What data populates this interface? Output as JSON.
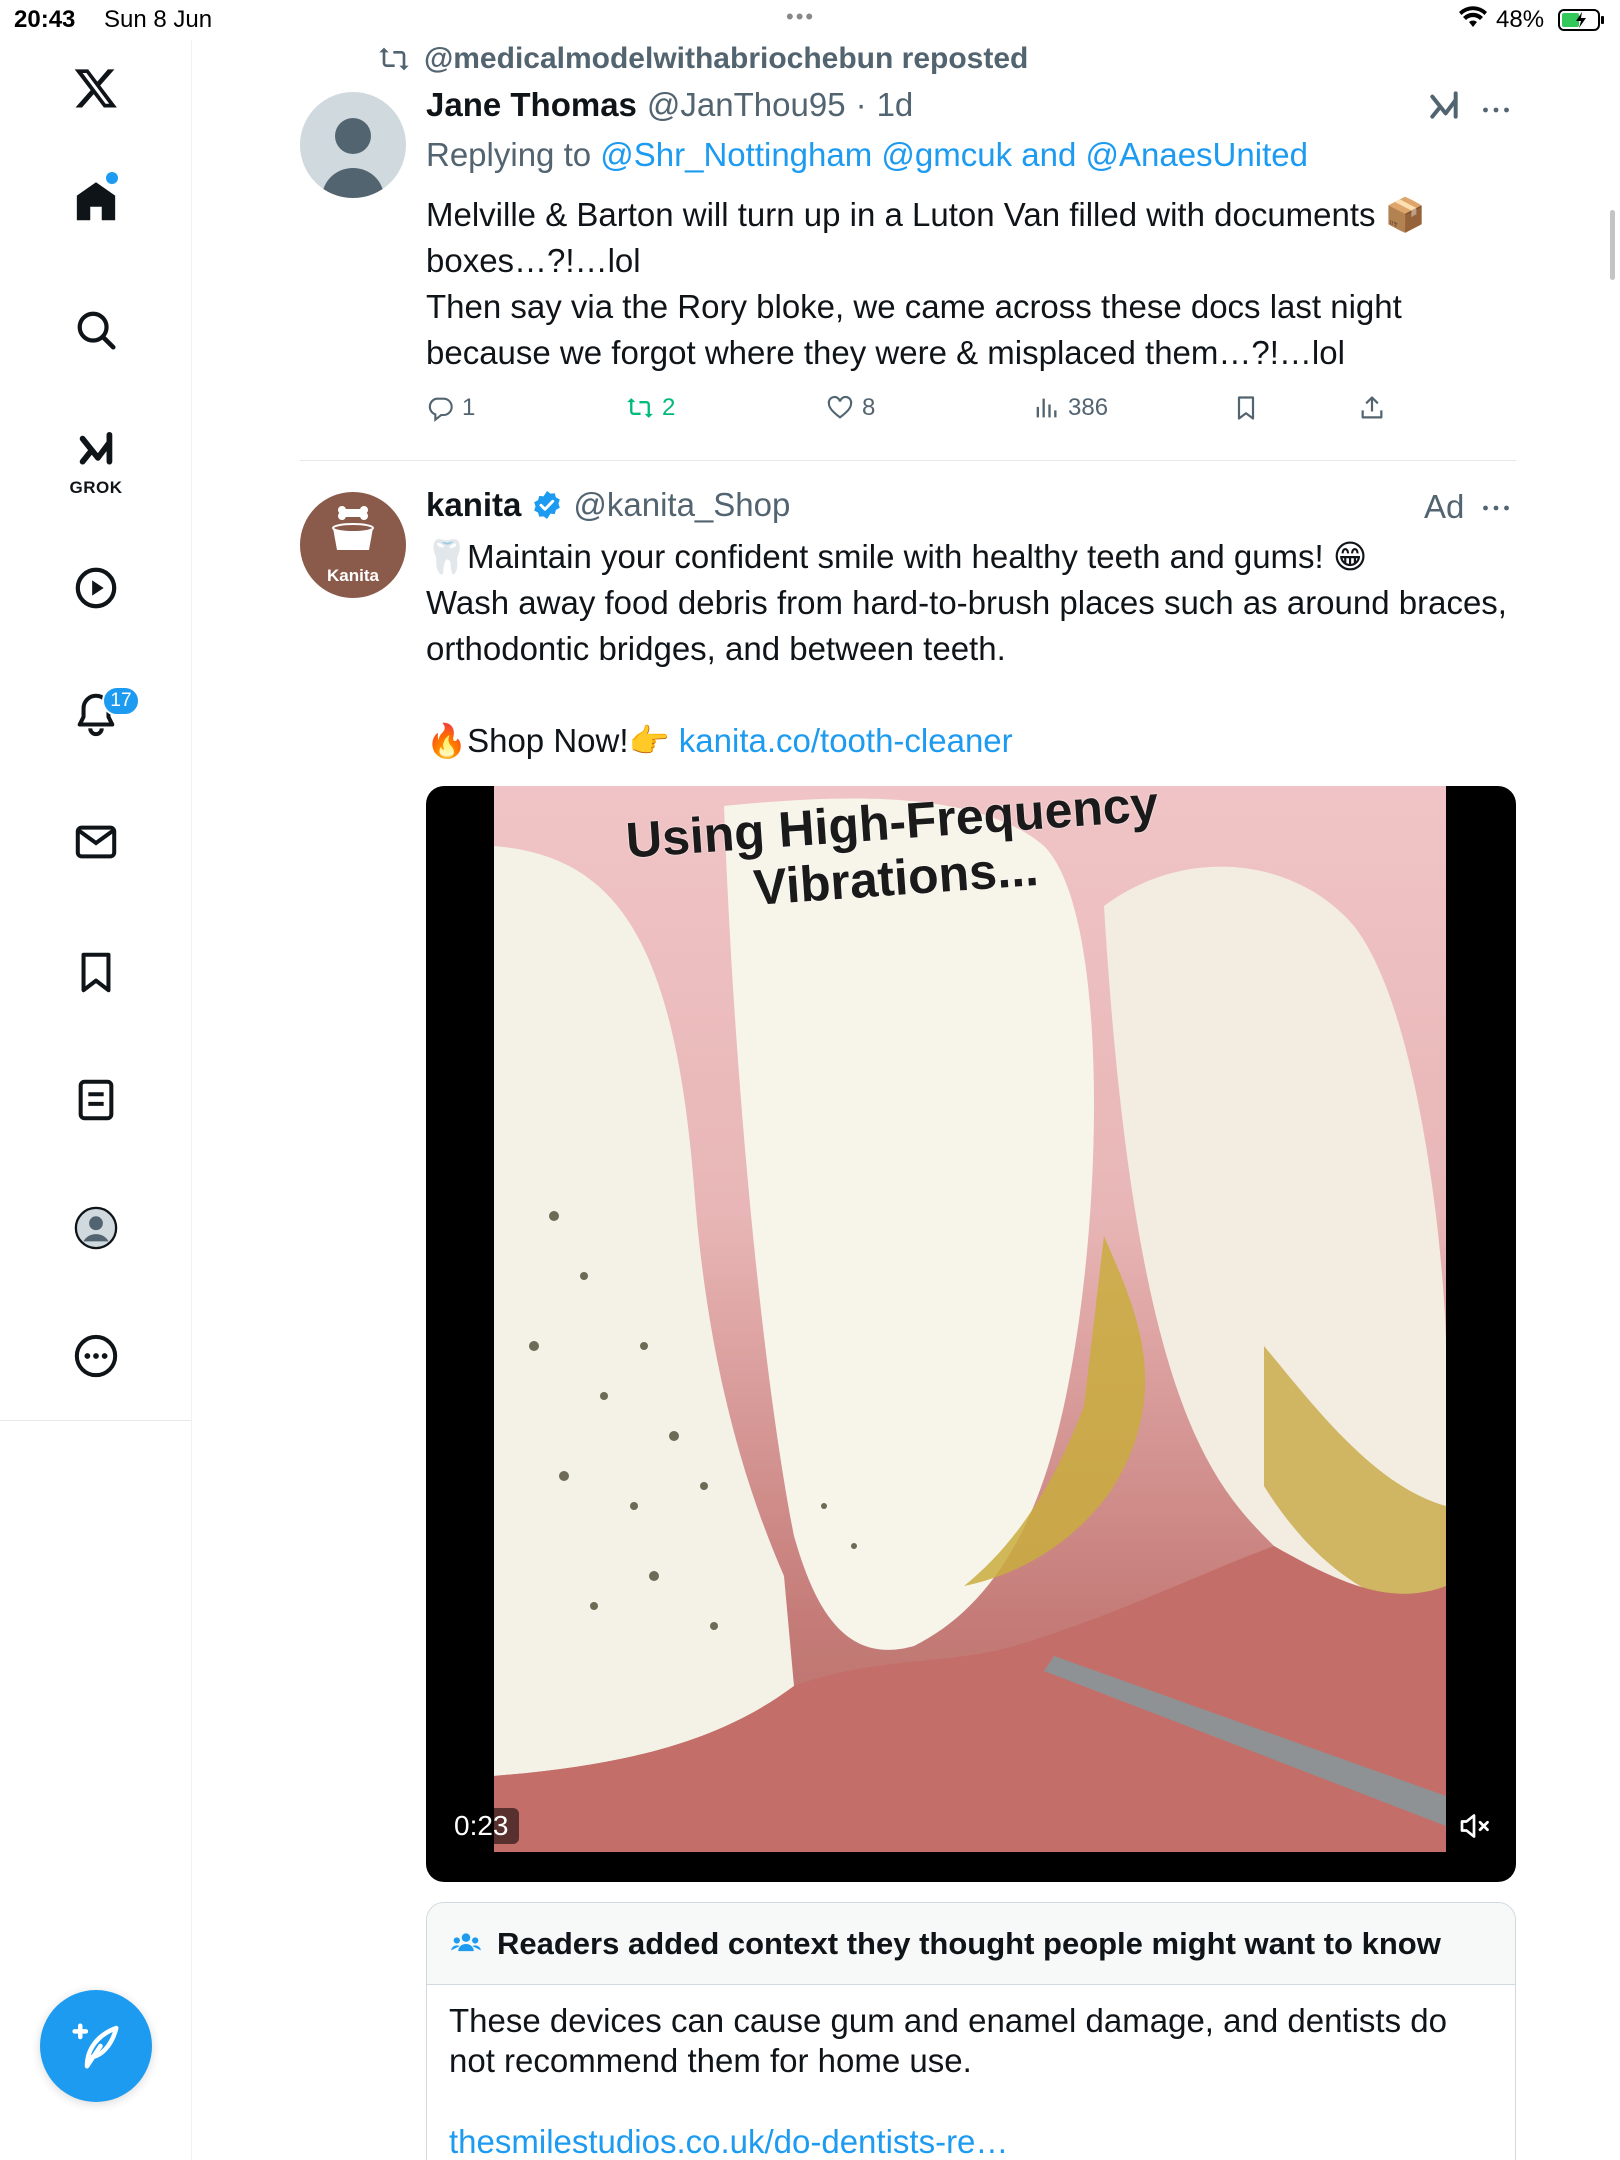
{
  "status_bar": {
    "time": "20:43",
    "date": "Sun 8 Jun",
    "battery": "48%"
  },
  "sidebar": {
    "items": [
      {
        "name": "x-logo-icon"
      },
      {
        "name": "home-icon"
      },
      {
        "name": "search-icon"
      },
      {
        "name": "grok-icon",
        "label": "GROK"
      },
      {
        "name": "video-icon"
      },
      {
        "name": "notifications-icon",
        "badge": "17"
      },
      {
        "name": "messages-icon"
      },
      {
        "name": "bookmarks-icon"
      },
      {
        "name": "lists-icon"
      },
      {
        "name": "profile-icon"
      },
      {
        "name": "more-icon"
      }
    ],
    "compose_icon": "compose-icon"
  },
  "tweet": {
    "repost_label": "@medicalmodelwithabriochebun reposted",
    "author_name": "Jane Thomas",
    "author_handle": "@JanThou95",
    "separator": "·",
    "time": "1d",
    "replying_prefix": "Replying to ",
    "replying_to": "@Shr_Nottingham @gmcuk and @AnaesUnited",
    "body_line1": "Melville & Barton will turn up in a Luton Van filled with documents 📦 boxes…?!…lol",
    "body_line2": "Then say via the Rory bloke, we came across these docs last night because we forgot where they were & misplaced them…?!…lol",
    "replies": "1",
    "reposts": "2",
    "likes": "8",
    "views": "386"
  },
  "ad": {
    "author_name": "kanita",
    "author_handle": "@kanita_Shop",
    "avatar_label": "Kanita",
    "ad_label": "Ad",
    "body_line1": "🦷Maintain your confident smile with healthy teeth and gums! 😁",
    "body_line2": "Wash away food debris from hard-to-brush places such as around braces, orthodontic bridges, and between teeth.",
    "shop_text": "🔥Shop Now!👉 ",
    "shop_link": "kanita.co/tooth-cleaner",
    "video_caption_line1": "Using High-Frequency",
    "video_caption_line2": "Vibrations...",
    "video_duration": "0:23"
  },
  "context_note": {
    "header": "Readers added context they thought people might want to know",
    "body": "These devices can cause gum and enamel damage, and dentists do not recommend them for home use.",
    "link": "thesmilestudios.co.uk/do-dentists-re…"
  },
  "colors": {
    "accent": "#1d9bf0",
    "repost_green": "#00ba7c",
    "secondary_text": "#536471"
  }
}
